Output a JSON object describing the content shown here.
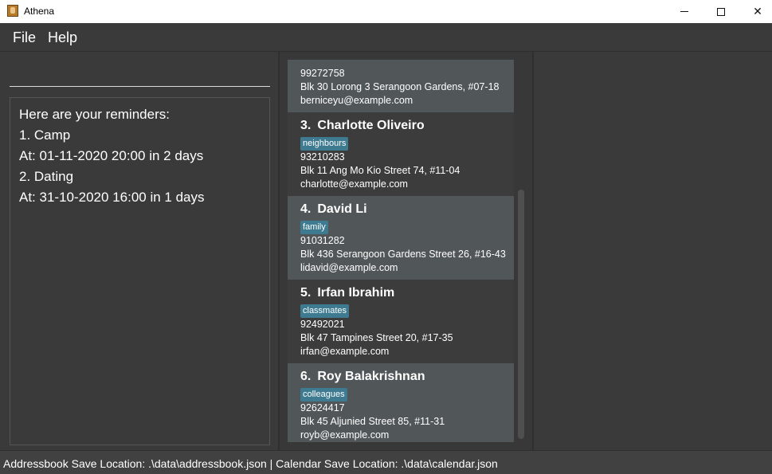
{
  "window": {
    "title": "Athena"
  },
  "menu": {
    "file": "File",
    "help": "Help"
  },
  "command": {
    "value": ""
  },
  "result": {
    "lines": [
      "Here are your reminders:",
      "1. Camp",
      "At: 01-11-2020 20:00 in 2 days",
      "2. Dating",
      "At: 31-10-2020 16:00 in 1 days"
    ]
  },
  "contacts": [
    {
      "phone": "99272758",
      "address": "Blk 30 Lorong 3 Serangoon Gardens, #07-18",
      "email": "berniceyu@example.com"
    },
    {
      "index": "3.",
      "name": "Charlotte Oliveiro",
      "tag": "neighbours",
      "phone": "93210283",
      "address": "Blk 11 Ang Mo Kio Street 74, #11-04",
      "email": "charlotte@example.com"
    },
    {
      "index": "4.",
      "name": "David Li",
      "tag": "family",
      "phone": "91031282",
      "address": "Blk 436 Serangoon Gardens Street 26, #16-43",
      "email": "lidavid@example.com"
    },
    {
      "index": "5.",
      "name": "Irfan Ibrahim",
      "tag": "classmates",
      "phone": "92492021",
      "address": "Blk 47 Tampines Street 20, #17-35",
      "email": "irfan@example.com"
    },
    {
      "index": "6.",
      "name": "Roy Balakrishnan",
      "tag": "colleagues",
      "phone": "92624417",
      "address": "Blk 45 Aljunied Street 85, #11-31",
      "email": "royb@example.com"
    }
  ],
  "status": {
    "text": "Addressbook Save Location: .\\data\\addressbook.json | Calendar Save Location: .\\data\\calendar.json"
  },
  "colors": {
    "tag": "#3e7b91",
    "card_highlight": "#515658",
    "background": "#3a3a3a"
  }
}
